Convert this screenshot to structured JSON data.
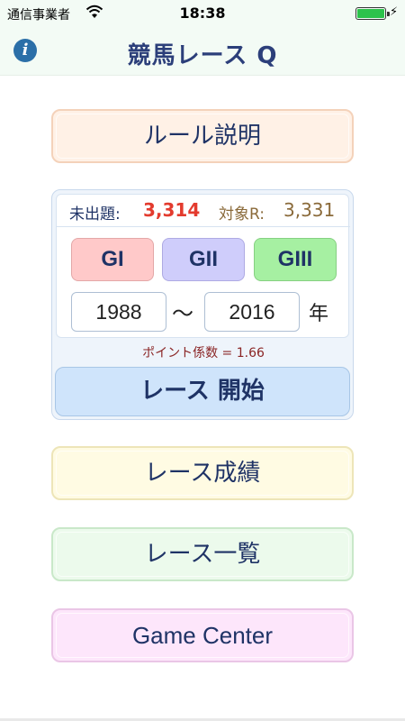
{
  "status_bar": {
    "carrier": "通信事業者",
    "time": "18:38",
    "battery_level": 1.0
  },
  "nav": {
    "title": "競馬レース Q",
    "info_icon": "i"
  },
  "menu": {
    "rules_label": "ルール説明",
    "results_label": "レース成績",
    "list_label": "レース一覧",
    "game_center_label": "Game Center"
  },
  "race": {
    "unasked_label": "未出題:",
    "unasked_value": "3,314",
    "target_label": "対象R:",
    "target_value": "3,331",
    "grades": [
      "GI",
      "GII",
      "GIII"
    ],
    "year_from": "1988",
    "tilde": "〜",
    "year_to": "2016",
    "year_unit": "年",
    "coefficient": "ポイント係数 = 1.66",
    "start_label": "レース 開始"
  },
  "colors": {
    "title": "#2c3f7a",
    "unasked_value": "#e33b2e",
    "target": "#8a6a3a",
    "coefficient": "#8a2424",
    "gi": "#ffc9c9",
    "gii": "#cfcdfb",
    "giii": "#a6f0a2"
  }
}
